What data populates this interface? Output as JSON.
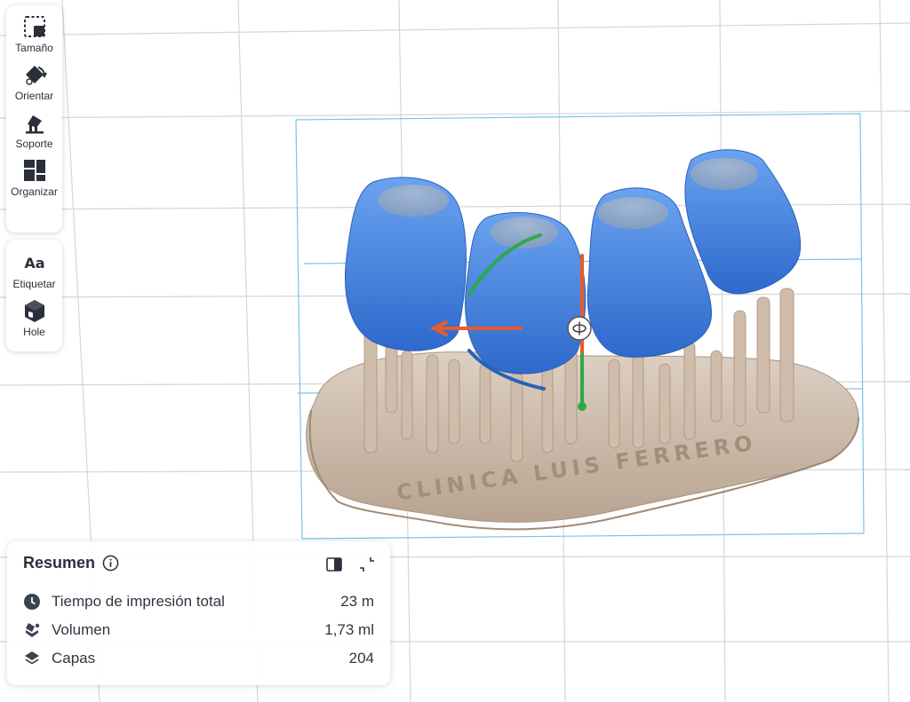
{
  "toolbar": {
    "main_tools": [
      {
        "label": "Tamaño",
        "icon": "resize-icon"
      },
      {
        "label": "Orientar",
        "icon": "orient-icon"
      },
      {
        "label": "Soporte",
        "icon": "support-icon"
      },
      {
        "label": "Organizar",
        "icon": "layout-icon"
      }
    ],
    "extra_tools": [
      {
        "label": "Etiquetar",
        "icon": "label-icon",
        "glyph": "Aa"
      },
      {
        "label": "Hole",
        "icon": "hole-icon"
      }
    ]
  },
  "summary": {
    "title": "Resumen",
    "rows": [
      {
        "label": "Tiempo de impresión total",
        "value": "23 m",
        "icon": "clock-icon"
      },
      {
        "label": "Volumen",
        "value": "1,73 ml",
        "icon": "volume-icon"
      },
      {
        "label": "Capas",
        "value": "204",
        "icon": "layers-icon"
      }
    ]
  },
  "model": {
    "base_engraving": "CLINICA LUIS FERRERO"
  },
  "colors": {
    "grid": "#d8d8d8",
    "bounding_box": "#7bc3ea",
    "crowns": "#3f7ee0",
    "base": "#cdb9a6",
    "gizmo_x": "#e65c2a",
    "gizmo_y": "#2fa84a",
    "gizmo_z": "#2563b5",
    "text": "#2b313c"
  }
}
